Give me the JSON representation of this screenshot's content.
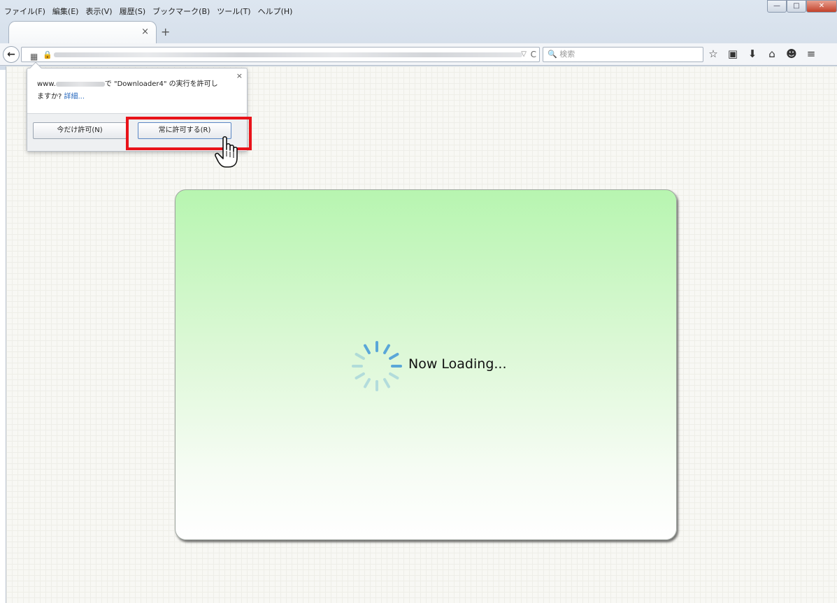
{
  "menubar": {
    "items": [
      "ファイル(F)",
      "編集(E)",
      "表示(V)",
      "履歴(S)",
      "ブックマーク(B)",
      "ツール(T)",
      "ヘルプ(H)"
    ]
  },
  "window_controls": {
    "minimize": "—",
    "maximize": "□",
    "close": "✕"
  },
  "tab": {
    "close": "×",
    "new_tab": "+"
  },
  "navbar": {
    "back": "←",
    "plugin_icon": "▦",
    "lock": "🔒",
    "dropdown": "▽",
    "reload": "C",
    "search_placeholder": "🔍 検索",
    "icons": [
      "☆",
      "▣",
      "⬇",
      "⌂",
      "☻",
      "≡"
    ]
  },
  "popup": {
    "host_prefix": "www.",
    "message_part1": "で \"Downloader4\" の実行を許可し",
    "message_part2": "ますか?",
    "details_link": "詳細...",
    "close": "×",
    "allow_now_label": "今だけ許可(N)",
    "allow_always_label": "常に許可する(R)"
  },
  "main": {
    "loading_text": "Now Loading..."
  },
  "colors": {
    "highlight": "#e8131a",
    "card_top": "#b7f5b0",
    "spinner": "#5aa7d8"
  }
}
